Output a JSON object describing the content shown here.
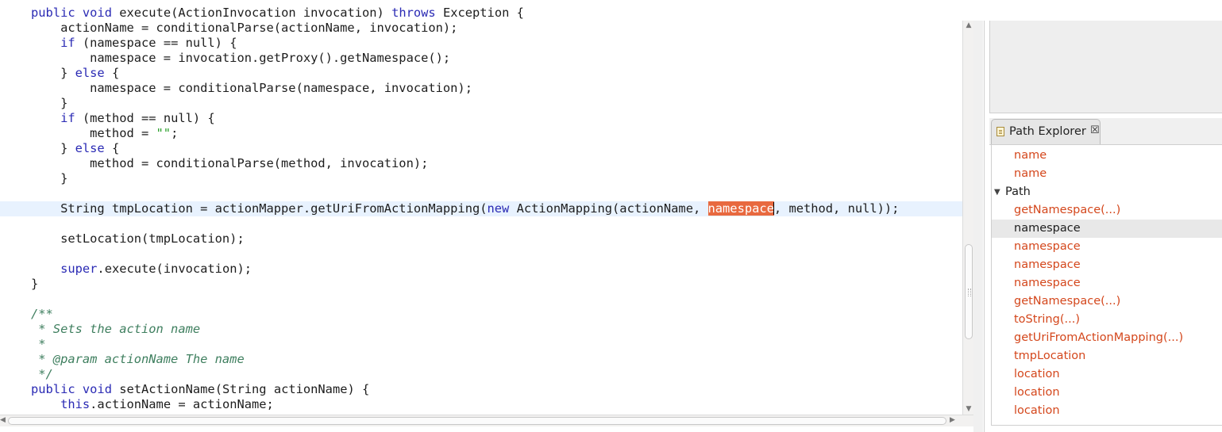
{
  "editor": {
    "lines": [
      {
        "segs": [
          {
            "t": "public void execute(ActionInvocation invocation) throws Exception {",
            "c": "partial"
          }
        ]
      },
      {
        "segs": [
          {
            "t": "    actionName = conditionalParse(actionName, invocation);"
          }
        ]
      },
      {
        "segs": [
          {
            "t": "    "
          },
          {
            "t": "if",
            "c": "kw"
          },
          {
            "t": " (namespace == null) {"
          }
        ]
      },
      {
        "segs": [
          {
            "t": "        namespace = invocation.getProxy().getNamespace();"
          }
        ]
      },
      {
        "segs": [
          {
            "t": "    } "
          },
          {
            "t": "else",
            "c": "kw"
          },
          {
            "t": " {"
          }
        ]
      },
      {
        "segs": [
          {
            "t": "        namespace = conditionalParse(namespace, invocation);"
          }
        ]
      },
      {
        "segs": [
          {
            "t": "    }"
          }
        ]
      },
      {
        "segs": [
          {
            "t": "    "
          },
          {
            "t": "if",
            "c": "kw"
          },
          {
            "t": " (method == null) {"
          }
        ]
      },
      {
        "segs": [
          {
            "t": "        method = "
          },
          {
            "t": "\"\"",
            "c": "str"
          },
          {
            "t": ";"
          }
        ]
      },
      {
        "segs": [
          {
            "t": "    } "
          },
          {
            "t": "else",
            "c": "kw"
          },
          {
            "t": " {"
          }
        ]
      },
      {
        "segs": [
          {
            "t": "        method = conditionalParse(method, invocation);"
          }
        ]
      },
      {
        "segs": [
          {
            "t": "    }"
          }
        ]
      },
      {
        "segs": [
          {
            "t": ""
          }
        ]
      },
      {
        "current": true,
        "segs": [
          {
            "t": "    String tmpLocation = actionMapper.getUriFromActionMapping("
          },
          {
            "t": "new",
            "c": "kw"
          },
          {
            "t": " ActionMapping(actionName, "
          },
          {
            "t": "namespace",
            "c": "hl"
          },
          {
            "t": "",
            "c": "caret"
          },
          {
            "t": ", method, null));"
          }
        ]
      },
      {
        "segs": [
          {
            "t": ""
          }
        ]
      },
      {
        "segs": [
          {
            "t": "    setLocation(tmpLocation);"
          }
        ]
      },
      {
        "segs": [
          {
            "t": ""
          }
        ]
      },
      {
        "segs": [
          {
            "t": "    "
          },
          {
            "t": "super",
            "c": "kw"
          },
          {
            "t": ".execute(invocation);"
          }
        ]
      },
      {
        "segs": [
          {
            "t": "}"
          }
        ]
      },
      {
        "segs": [
          {
            "t": ""
          }
        ]
      },
      {
        "segs": [
          {
            "t": "/**",
            "c": "doc"
          }
        ]
      },
      {
        "segs": [
          {
            "t": " * Sets the action name",
            "c": "doc"
          }
        ]
      },
      {
        "segs": [
          {
            "t": " *",
            "c": "doc"
          }
        ]
      },
      {
        "segs": [
          {
            "t": " * @param actionName The name",
            "c": "doc"
          }
        ]
      },
      {
        "segs": [
          {
            "t": " */",
            "c": "doc"
          }
        ]
      },
      {
        "segs": [
          {
            "t": "public",
            "c": "kw"
          },
          {
            "t": " "
          },
          {
            "t": "void",
            "c": "kw"
          },
          {
            "t": " setActionName(String actionName) {"
          }
        ]
      },
      {
        "segs": [
          {
            "t": "    "
          },
          {
            "t": "this",
            "c": "kw"
          },
          {
            "t": ".actionName = actionName;"
          }
        ]
      }
    ]
  },
  "path_explorer": {
    "tab_label": "Path Explorer",
    "close_glyph": "☒",
    "items": [
      {
        "label": "name",
        "style": "orange",
        "indent": 1
      },
      {
        "label": "name",
        "style": "orange",
        "indent": 1
      },
      {
        "label": "Path",
        "style": "dark",
        "indent": 0,
        "expanded": true
      },
      {
        "label": "getNamespace(...)",
        "style": "orange",
        "indent": 1
      },
      {
        "label": "namespace",
        "style": "dark",
        "indent": 1,
        "selected": true
      },
      {
        "label": "namespace",
        "style": "orange",
        "indent": 1
      },
      {
        "label": "namespace",
        "style": "orange",
        "indent": 1
      },
      {
        "label": "namespace",
        "style": "orange",
        "indent": 1
      },
      {
        "label": "getNamespace(...)",
        "style": "orange",
        "indent": 1
      },
      {
        "label": "toString(...)",
        "style": "orange",
        "indent": 1
      },
      {
        "label": "getUriFromActionMapping(...)",
        "style": "orange",
        "indent": 1
      },
      {
        "label": "tmpLocation",
        "style": "orange",
        "indent": 1
      },
      {
        "label": "location",
        "style": "orange",
        "indent": 1
      },
      {
        "label": "location",
        "style": "orange",
        "indent": 1
      },
      {
        "label": "location",
        "style": "orange",
        "indent": 1
      }
    ]
  },
  "colors": {
    "keyword": "#2a2ab4",
    "string": "#2aa02a",
    "javadoc": "#3f7f5f",
    "highlight": "#e8693f",
    "tree_item": "#d4471c"
  },
  "icons": [
    "path-explorer-view-icon",
    "close-icon",
    "expand-triangle-icon",
    "scroll-up-arrow-icon",
    "scroll-down-arrow-icon",
    "scroll-left-arrow-icon",
    "scroll-right-arrow-icon"
  ]
}
